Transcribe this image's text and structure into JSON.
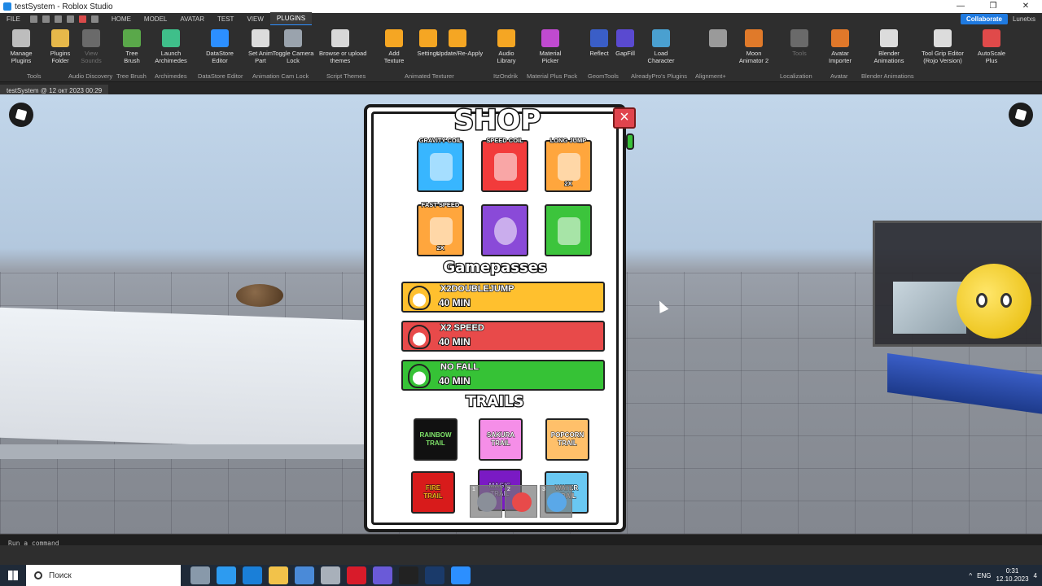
{
  "window": {
    "title": "testSystem - Roblox Studio"
  },
  "menu": {
    "tabs": [
      "FILE",
      "HOME",
      "MODEL",
      "AVATAR",
      "TEST",
      "VIEW",
      "PLUGINS"
    ],
    "active_tab": "PLUGINS",
    "collaborate": "Collaborate",
    "user": "Lunetxs"
  },
  "ribbon": {
    "buttons": [
      {
        "label": "Manage\nPlugins",
        "color": "#bdbdbd"
      },
      {
        "label": "Plugins\nFolder",
        "color": "#e6b84a"
      },
      {
        "label": "View\nSounds",
        "color": "#6a6a6a"
      },
      {
        "label": "Tree\nBrush",
        "color": "#5aa84a"
      },
      {
        "label": "Launch\nArchimedes",
        "color": "#3fbf8a"
      },
      {
        "label": "DataStore\nEditor",
        "color": "#2c8fff"
      },
      {
        "label": "Set Anim\nPart",
        "color": "#dcdcdc"
      },
      {
        "label": "Toggle Camera\nLock",
        "color": "#9aa3ad"
      },
      {
        "label": "Browse or upload\nthemes",
        "color": "#d8d8d8"
      },
      {
        "label": "Add\nTexture",
        "color": "#f5a623"
      },
      {
        "label": "Settings",
        "color": "#f5a623"
      },
      {
        "label": "Update/Re-Apply",
        "color": "#f5a623"
      },
      {
        "label": "Audio\nLibrary",
        "color": "#f5a623"
      },
      {
        "label": "Material\nPicker",
        "color": "#c04ad0"
      },
      {
        "label": "Reflect",
        "color": "#3a5ec7"
      },
      {
        "label": "GapFill",
        "color": "#5a4ad0"
      },
      {
        "label": "Load\nCharacter",
        "color": "#4aa0d0"
      },
      {
        "label": "",
        "color": "#9a9a9a"
      },
      {
        "label": "Moon\nAnimator 2",
        "color": "#e07a2a"
      },
      {
        "label": "Tools",
        "color": "#6a6a6a"
      },
      {
        "label": "Avatar\nImporter",
        "color": "#e0782a"
      },
      {
        "label": "Blender\nAnimations",
        "color": "#dcdcdc"
      },
      {
        "label": "Tool Grip Editor\n(Rojo Version)",
        "color": "#dcdcdc"
      },
      {
        "label": "AutoScale\nPlus",
        "color": "#e04a4a"
      }
    ],
    "groups": [
      "Tools",
      "Audio Discovery",
      "Tree Brush",
      "Archimedes",
      "DataStore Editor",
      "Animation Cam Lock",
      "Script Themes",
      "Animated Texturer",
      "ItzOndrik",
      "Material Plus Pack",
      "GeomTools",
      "AlreadyPro's Plugins",
      "Alignment+",
      "Localization",
      "Avatar",
      "Blender Animations"
    ]
  },
  "doc_tab": "testSystem @ 12 окт 2023 00:29",
  "shop": {
    "title": "SHOP",
    "close": "×",
    "items": [
      {
        "label": "GRAVITY COIL",
        "color": "#38b6ff",
        "mult": ""
      },
      {
        "label": "SPEED COIL",
        "color": "#f23b3b",
        "mult": ""
      },
      {
        "label": "LONG JUMP",
        "color": "#ffa63d",
        "mult": "2X"
      },
      {
        "label": "FAST SPEED",
        "color": "#ffa63d",
        "mult": "2X"
      },
      {
        "label": "",
        "color": "#8a4ad8",
        "mult": ""
      },
      {
        "label": "",
        "color": "#3cc43c",
        "mult": ""
      }
    ],
    "gamepasses_title": "Gamepasses",
    "gamepasses": [
      {
        "name": "X2DOUBLEJUMP",
        "time": "40 MIN",
        "color": "#ffc02e"
      },
      {
        "name": "X2 SPEED",
        "time": "40 MIN",
        "color": "#e84a4a"
      },
      {
        "name": "NO FALL",
        "time": "40 MIN",
        "color": "#36c236"
      }
    ],
    "trails_title": "TRAILS",
    "trails": [
      {
        "label": "RAINBOW\nTRAIL",
        "bg": "#111111",
        "fg": "#7fe36a"
      },
      {
        "label": "SAKURA\nTRAIL",
        "bg": "#f58ee8",
        "fg": "#ffffff"
      },
      {
        "label": "POPCORN\nTRAIL",
        "bg": "#ffc06a",
        "fg": "#ffffff"
      },
      {
        "label": "FIRE\nTRAIL",
        "bg": "#d81b1b",
        "fg": "#ffb01a"
      },
      {
        "label": "MAGIC\nTRAIL",
        "bg": "#7a1ac4",
        "fg": "#c08aff"
      },
      {
        "label": "WATER\nTRAIL",
        "bg": "#69c8f2",
        "fg": "#ffffff"
      }
    ]
  },
  "hotbar": [
    {
      "slot": "1",
      "color": "#8a8f99"
    },
    {
      "slot": "2",
      "color": "#e84a4a"
    },
    {
      "slot": "3",
      "color": "#5aa8e8"
    }
  ],
  "command_bar": {
    "placeholder": "Run a command"
  },
  "taskbar": {
    "search": "Поиск",
    "lang": "ENG",
    "time": "0:31",
    "date": "12.10.2023",
    "notifications": "4"
  }
}
